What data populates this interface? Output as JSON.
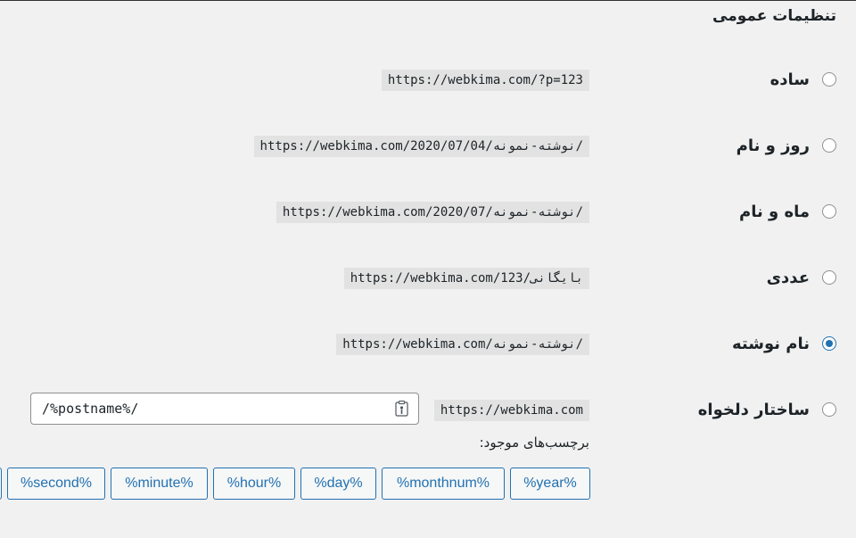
{
  "section": {
    "title": "تنظیمات عمومی"
  },
  "options": [
    {
      "label": "ساده",
      "example": "https://webkima.com/?p=123",
      "checked": false
    },
    {
      "label": "روز و نام",
      "example": "https://webkima.com/2020/07/04/نوشته-نمونه/",
      "checked": false
    },
    {
      "label": "ماه و نام",
      "example": "https://webkima.com/2020/07/نوشته-نمونه/",
      "checked": false
    },
    {
      "label": "عددی",
      "example": "https://webkima.com/بایگانی/123",
      "checked": false
    },
    {
      "label": "نام نوشته",
      "example": "https://webkima.com/نوشته-نمونه/",
      "checked": true
    },
    {
      "label": "ساختار دلخواه",
      "example": "https://webkima.com",
      "checked": false
    }
  ],
  "custom": {
    "value": "/%postname%/",
    "icon": "clipboard-icon"
  },
  "tags_label": "برچسب‌های موجود:",
  "tags": [
    "%year%",
    "%monthnum%",
    "%day%",
    "%hour%",
    "%minute%",
    "%second%"
  ],
  "colors": {
    "accent": "#2271b1",
    "background": "#f1f1f1",
    "code_bg": "#e2e2e2"
  }
}
